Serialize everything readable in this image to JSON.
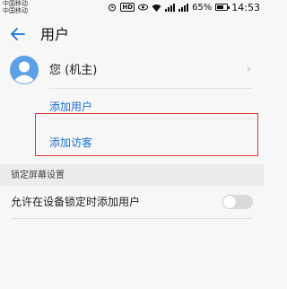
{
  "status_bar": {
    "carriers": [
      "中国移动",
      "中国移动"
    ],
    "battery_level": "65%",
    "battery_fraction": 0.65,
    "time": "14:53",
    "icons": [
      "alarm-icon",
      "hd-icon",
      "eye-icon",
      "wifi-icon",
      "signal-icon",
      "signal-icon",
      "battery-icon"
    ]
  },
  "app_bar": {
    "title": "用户",
    "back_icon": "back-arrow-icon",
    "accent_color": "#1a6fd8"
  },
  "current_user": {
    "name": "您 (机主)",
    "avatar_icon": "avatar-icon",
    "chevron_icon": "chevron-right-icon"
  },
  "actions": {
    "add_user": "添加用户",
    "add_guest": "添加访客"
  },
  "lock_screen_section": {
    "title": "锁定屏幕设置",
    "toggle_label": "允许在设备锁定时添加用户",
    "toggle_on": false
  },
  "colors": {
    "link": "#1a6fd8",
    "highlight_border": "#dd3333"
  }
}
